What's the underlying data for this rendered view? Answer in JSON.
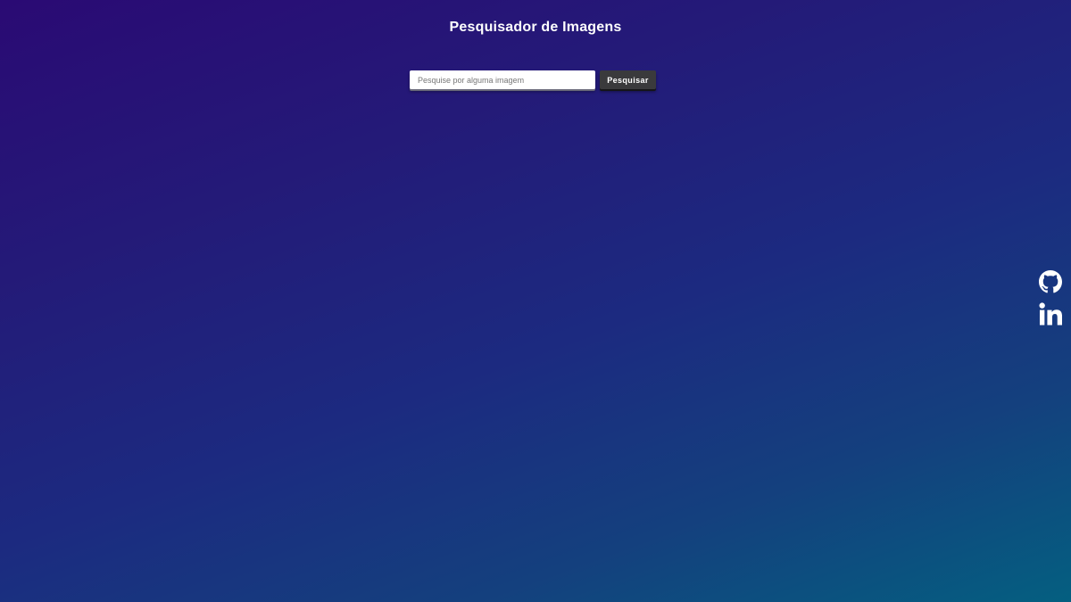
{
  "header": {
    "title": "Pesquisador de Imagens"
  },
  "search": {
    "placeholder": "Pesquise por alguma imagem",
    "value": "",
    "button_label": "Pesquisar"
  },
  "social": {
    "items": [
      {
        "icon": "github-icon"
      },
      {
        "icon": "linkedin-icon"
      }
    ]
  },
  "colors": {
    "background_start": "#2a0a74",
    "background_end": "#045f80",
    "button_bg": "#3a3a3c",
    "text": "#ffffff"
  }
}
